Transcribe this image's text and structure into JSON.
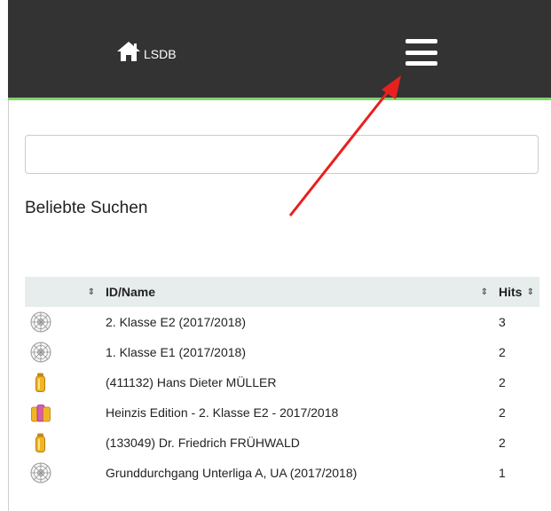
{
  "navbar": {
    "brand_label": "LSDB",
    "brand_icon": "home-icon",
    "menu_icon": "hamburger-menu-icon",
    "bg_color": "#333333",
    "accent_color": "#7fd66c"
  },
  "search": {
    "value": "",
    "placeholder": ""
  },
  "section": {
    "title": "Beliebte Suchen"
  },
  "table": {
    "columns": [
      "",
      "ID/Name",
      "Hits"
    ],
    "sort_icon": "⇕",
    "rows": [
      {
        "icon": "dartboard-icon",
        "name": "2. Klasse E2 (2017/2018)",
        "hits": "3"
      },
      {
        "icon": "dartboard-icon",
        "name": "1. Klasse E1 (2017/2018)",
        "hits": "2"
      },
      {
        "icon": "player-icon",
        "name": "(411132) Hans Dieter MÜLLER",
        "hits": "2"
      },
      {
        "icon": "team-icon",
        "name": "Heinzis Edition - 2. Klasse E2 - 2017/2018",
        "hits": "2"
      },
      {
        "icon": "player-icon",
        "name": "(133049) Dr. Friedrich FRÜHWALD",
        "hits": "2"
      },
      {
        "icon": "dartboard-icon",
        "name": "Grunddurchgang Unterliga A, UA (2017/2018)",
        "hits": "1"
      }
    ]
  },
  "annotation": {
    "arrow_color": "#e8201e"
  }
}
